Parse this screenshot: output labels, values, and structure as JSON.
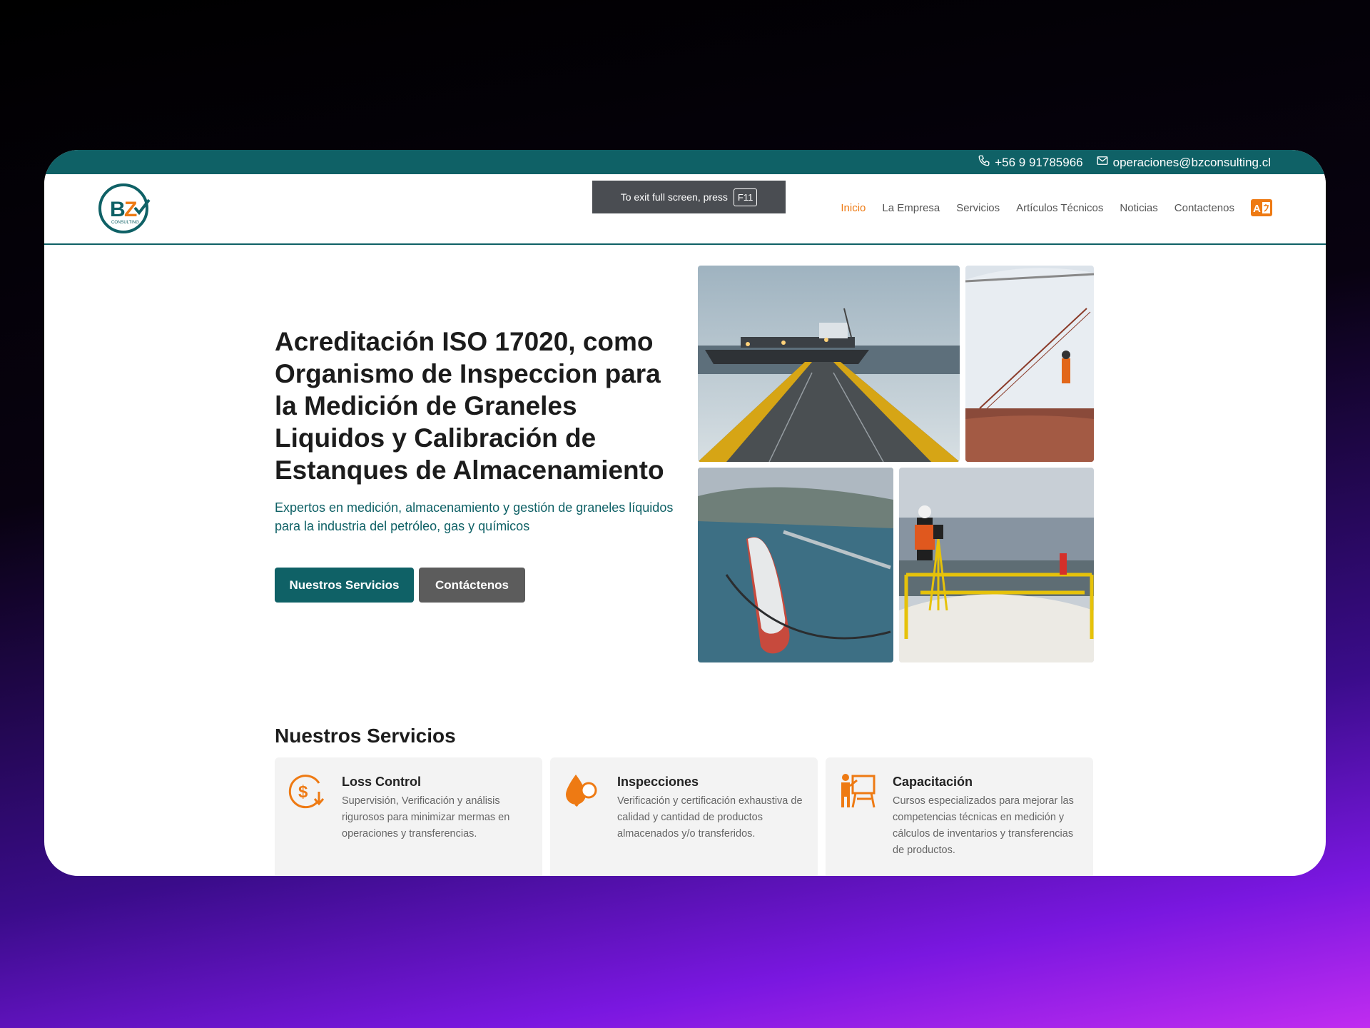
{
  "topbar": {
    "phone": "+56 9 91785966",
    "email": "operaciones@bzconsulting.cl"
  },
  "logo": {
    "letters": "BZ",
    "tag": "CONSULTING"
  },
  "fullscreen_notice": {
    "text": "To exit full screen, press",
    "key": "F11"
  },
  "nav": {
    "items": [
      {
        "label": "Inicio",
        "active": true
      },
      {
        "label": "La Empresa"
      },
      {
        "label": "Servicios"
      },
      {
        "label": "Artículos Técnicos"
      },
      {
        "label": "Noticias"
      },
      {
        "label": "Contactenos"
      }
    ],
    "language_icon": "translate-icon"
  },
  "hero": {
    "title": "Acreditación ISO 17020, como Organismo de Inspeccion para la Medición de Graneles Liquidos y Calibración de Estanques de Almacenamiento",
    "subtitle": "Expertos en medición, almacenamiento y gestión de graneles líquidos para la industria del petróleo, gas y químicos",
    "primary_button": "Nuestros Servicios",
    "secondary_button": "Contáctenos"
  },
  "services": {
    "title": "Nuestros Servicios",
    "cards": [
      {
        "title": "Loss Control",
        "description": "Supervisión, Verificación y análisis rigurosos para minimizar mermas en operaciones y transferencias.",
        "icon": "dollar-loss-icon"
      },
      {
        "title": "Inspecciones",
        "description": "Verificación y certificación exhaustiva de calidad y cantidad de productos almacenados y/o transferidos.",
        "icon": "inspection-search-icon"
      },
      {
        "title": "Capacitación",
        "description": "Cursos especializados para mejorar las competencias técnicas en medición y cálculos de inventarios y transferencias de productos.",
        "icon": "training-presentation-icon"
      }
    ]
  },
  "colors": {
    "brand_teal": "#0f6166",
    "accent_orange": "#ee7a13",
    "button_gray": "#5c5c5c"
  }
}
